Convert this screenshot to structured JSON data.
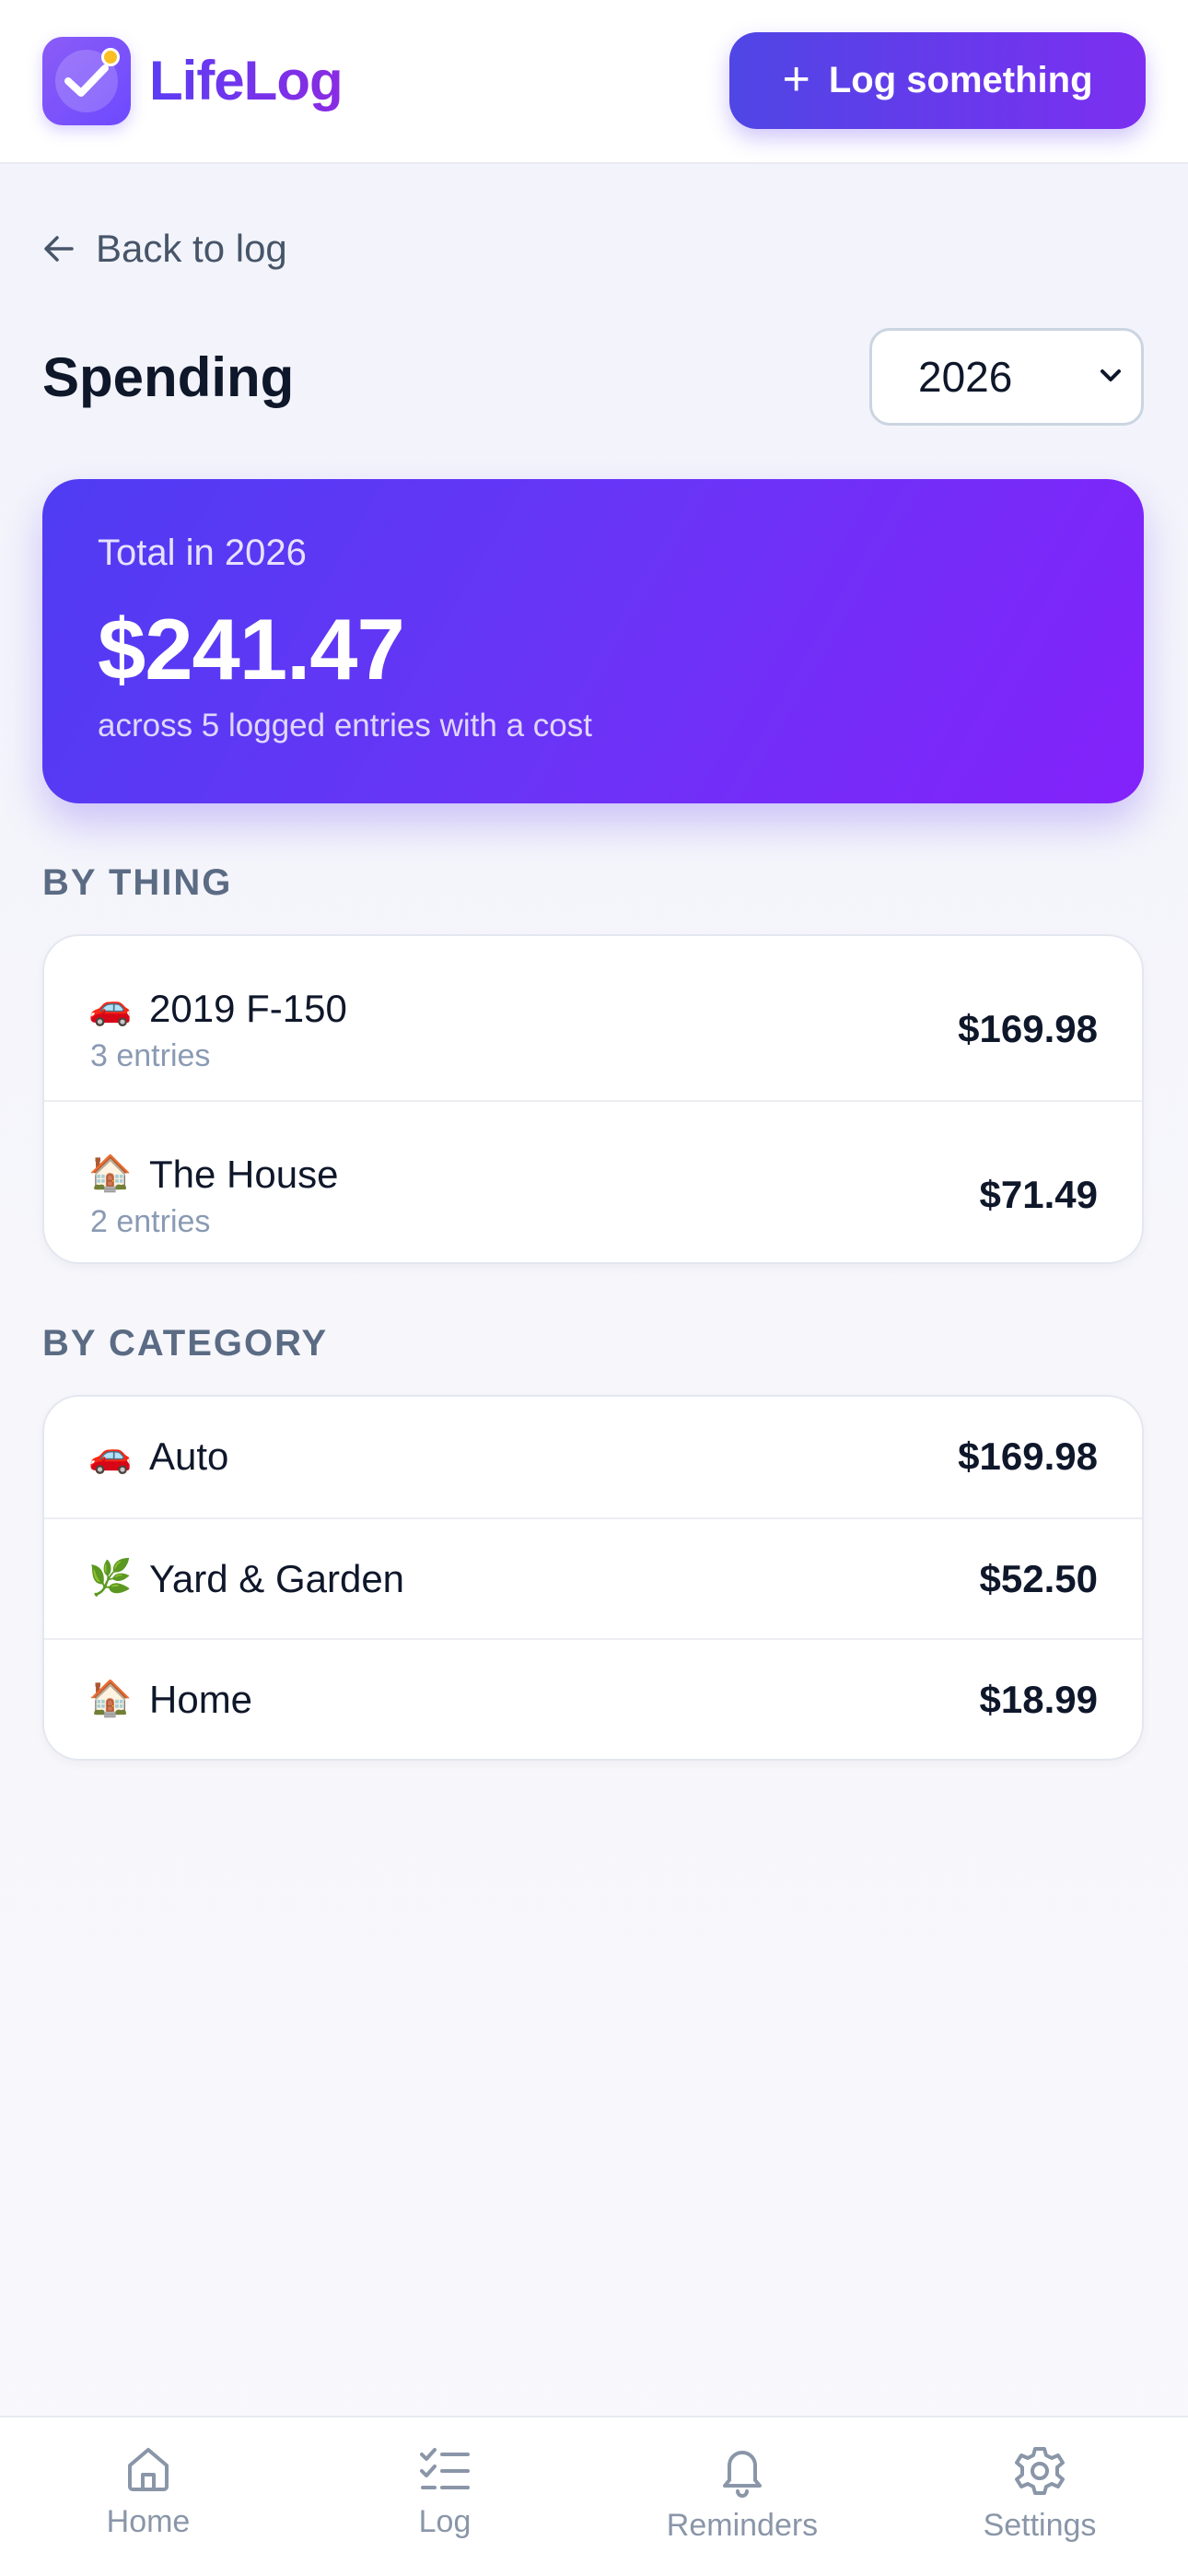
{
  "header": {
    "brand": "LifeLog",
    "log_button_label": "Log something"
  },
  "back_label": "Back to log",
  "page_title": "Spending",
  "year_select": {
    "selected": "2026"
  },
  "total": {
    "label": "Total in 2026",
    "amount": "$241.47",
    "subtext": "across 5 logged entries with a cost"
  },
  "by_thing": {
    "heading": "BY THING",
    "items": [
      {
        "emoji": "🚗",
        "name": "2019 F-150",
        "meta": "3 entries",
        "value": "$169.98"
      },
      {
        "emoji": "🏠",
        "name": "The House",
        "meta": "2 entries",
        "value": "$71.49"
      }
    ]
  },
  "by_category": {
    "heading": "BY CATEGORY",
    "items": [
      {
        "emoji": "🚗",
        "name": "Auto",
        "value": "$169.98"
      },
      {
        "emoji": "🌿",
        "name": "Yard & Garden",
        "value": "$52.50"
      },
      {
        "emoji": "🏠",
        "name": "Home",
        "value": "$18.99"
      }
    ]
  },
  "nav": {
    "items": [
      {
        "label": "Home",
        "icon": "home-icon"
      },
      {
        "label": "Log",
        "icon": "checklist-icon"
      },
      {
        "label": "Reminders",
        "icon": "bell-icon"
      },
      {
        "label": "Settings",
        "icon": "gear-icon"
      }
    ]
  },
  "colors": {
    "accent": "#5b3df5",
    "accent_end": "#8322fb",
    "muted": "#8a96a8"
  }
}
